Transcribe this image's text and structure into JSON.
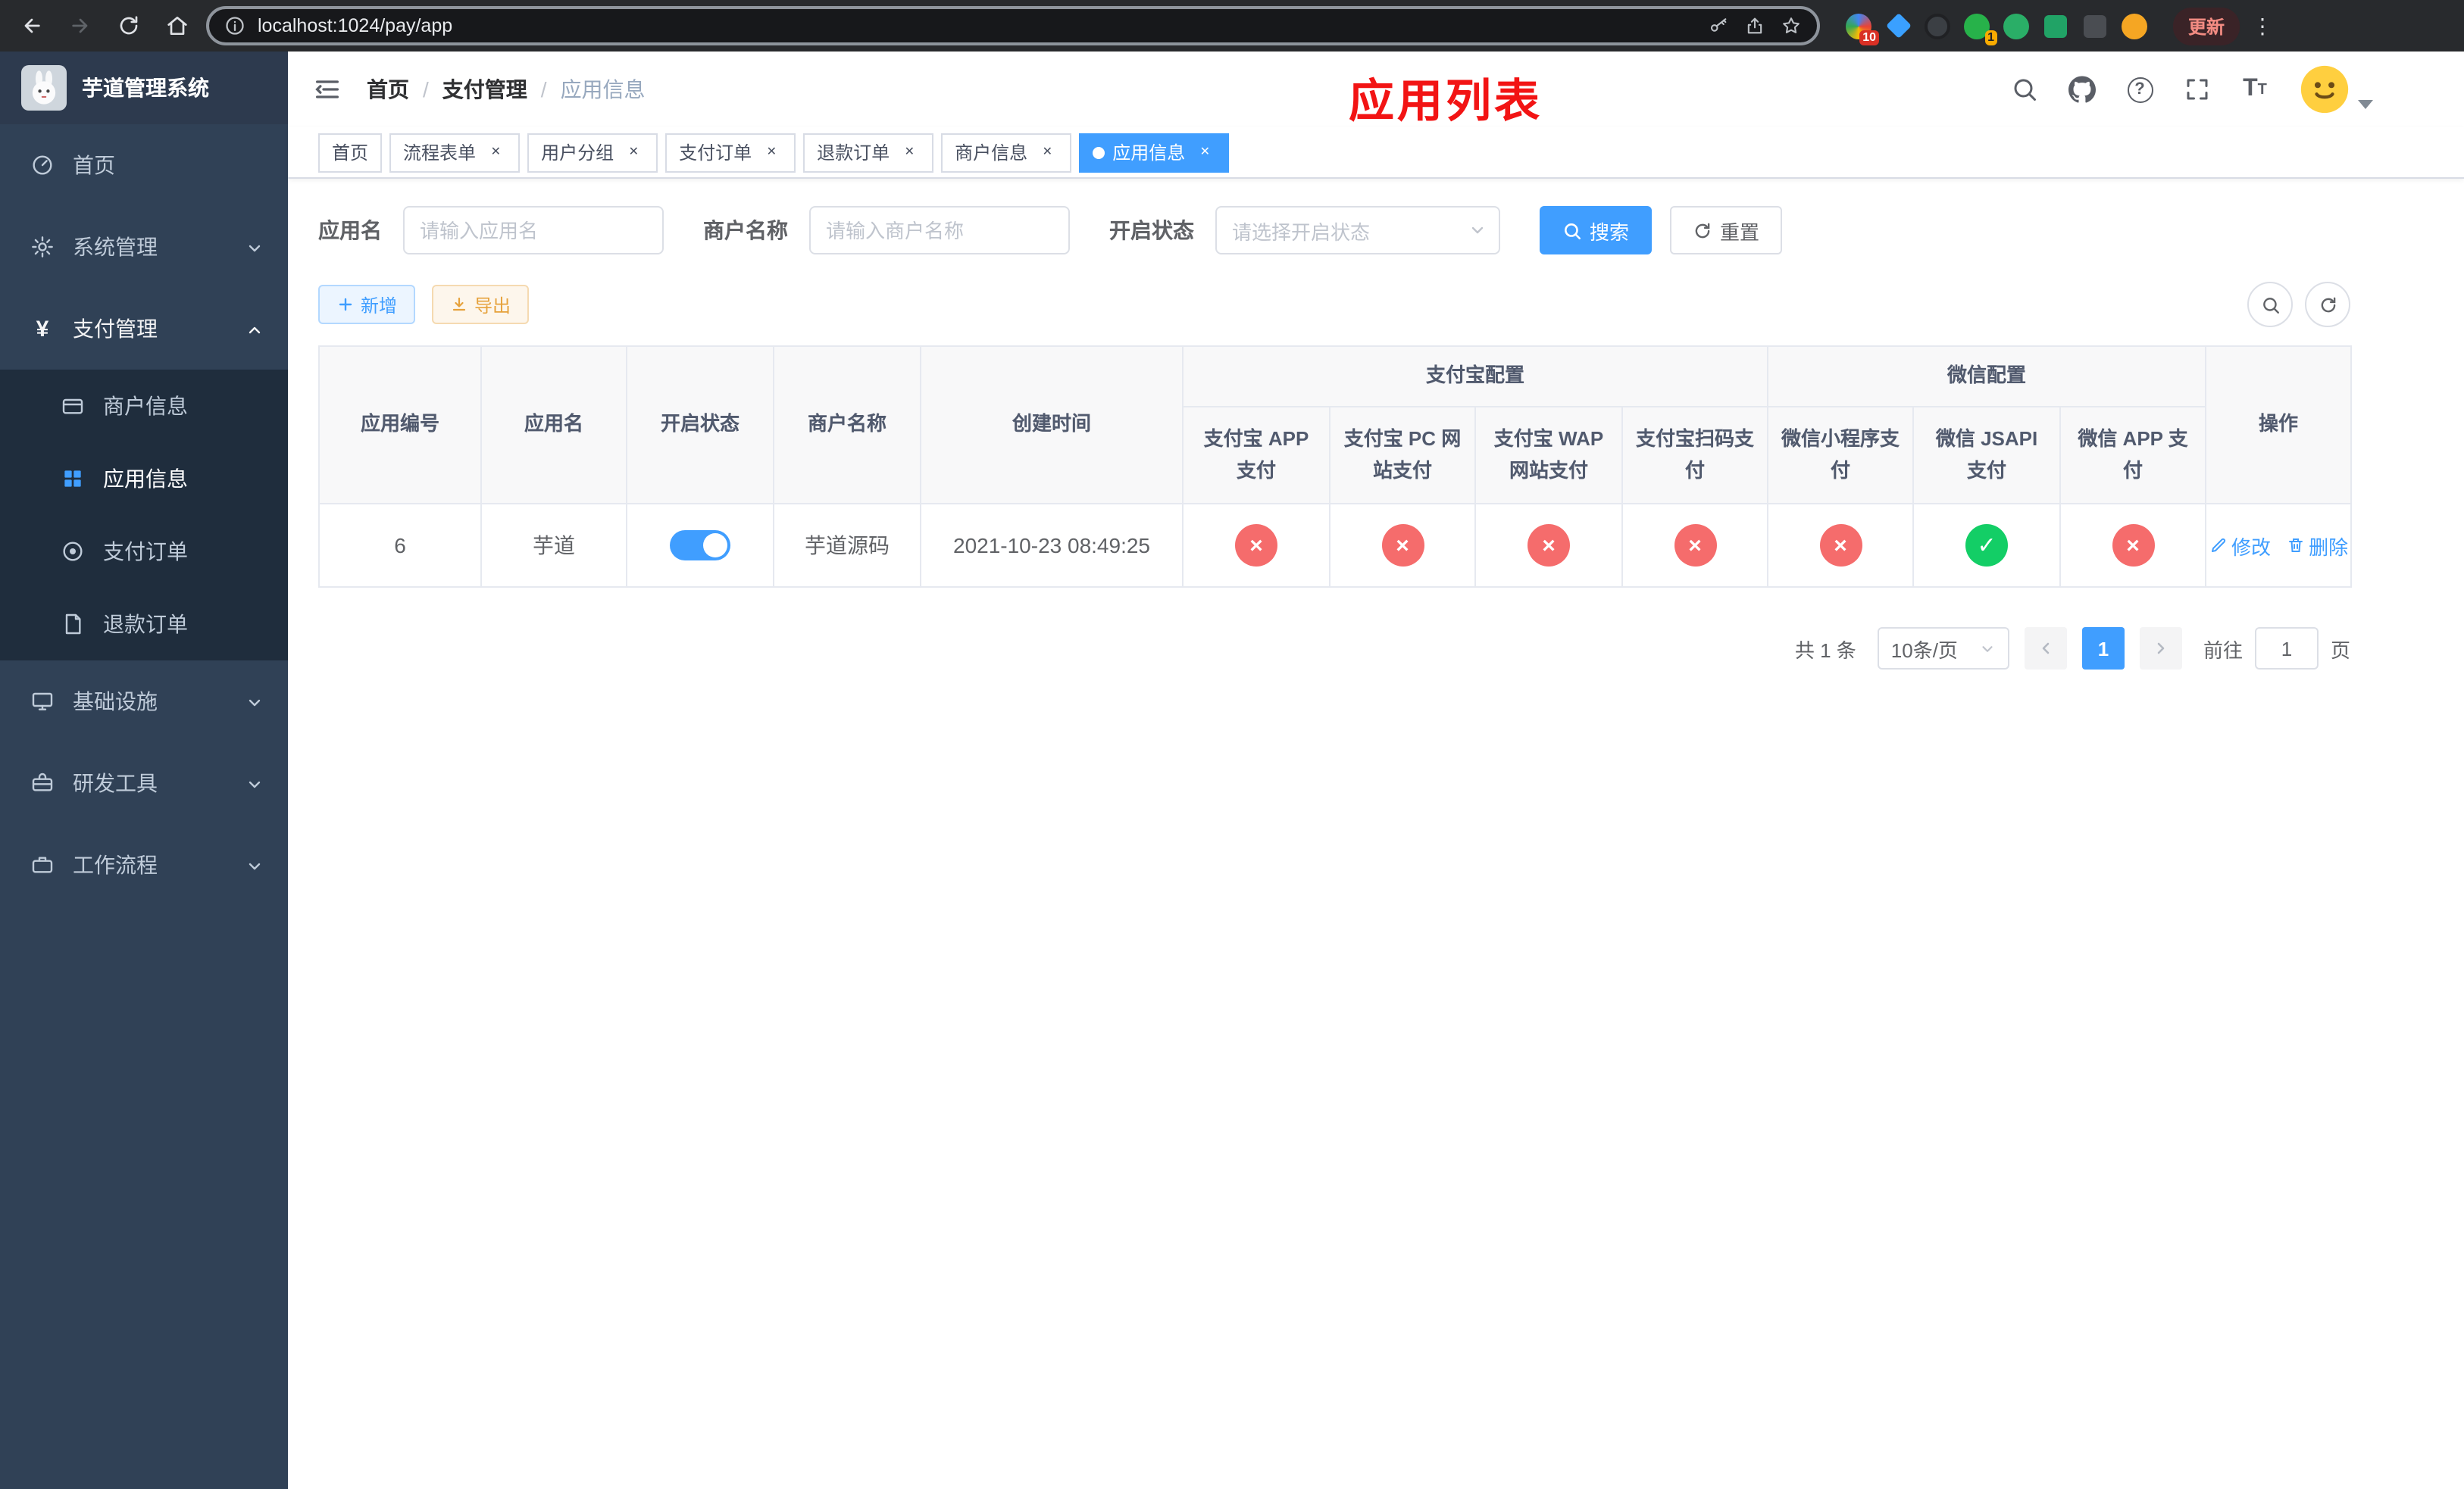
{
  "browser": {
    "url": "localhost:1024/pay/app",
    "update_label": "更新",
    "extension_badge_1": "10",
    "extension_badge_2": "1"
  },
  "sidebar": {
    "title": "芋道管理系统",
    "menu": [
      {
        "label": "首页"
      },
      {
        "label": "系统管理"
      },
      {
        "label": "支付管理"
      },
      {
        "label": "商户信息"
      },
      {
        "label": "应用信息"
      },
      {
        "label": "支付订单"
      },
      {
        "label": "退款订单"
      },
      {
        "label": "基础设施"
      },
      {
        "label": "研发工具"
      },
      {
        "label": "工作流程"
      }
    ]
  },
  "header": {
    "breadcrumb": [
      "首页",
      "支付管理",
      "应用信息"
    ],
    "page_title": "应用列表"
  },
  "tabs": [
    {
      "label": "首页"
    },
    {
      "label": "流程表单"
    },
    {
      "label": "用户分组"
    },
    {
      "label": "支付订单"
    },
    {
      "label": "退款订单"
    },
    {
      "label": "商户信息"
    },
    {
      "label": "应用信息"
    }
  ],
  "filters": {
    "app_name_label": "应用名",
    "app_name_placeholder": "请输入应用名",
    "merchant_label": "商户名称",
    "merchant_placeholder": "请输入商户名称",
    "status_label": "开启状态",
    "status_placeholder": "请选择开启状态",
    "search_label": "搜索",
    "reset_label": "重置"
  },
  "toolbar": {
    "add_label": "新增",
    "export_label": "导出"
  },
  "table": {
    "headers": {
      "app_id": "应用编号",
      "app_name": "应用名",
      "status": "开启状态",
      "merchant": "商户名称",
      "created": "创建时间",
      "alipay_group": "支付宝配置",
      "wechat_group": "微信配置",
      "alipay_app": "支付宝 APP 支付",
      "alipay_pc": "支付宝 PC 网站支付",
      "alipay_wap": "支付宝 WAP 网站支付",
      "alipay_qr": "支付宝扫码支付",
      "wx_mini": "微信小程序支付",
      "wx_jsapi": "微信 JSAPI 支付",
      "wx_app": "微信 APP 支付",
      "actions": "操作"
    },
    "rows": [
      {
        "app_id": "6",
        "app_name": "芋道",
        "status_on": true,
        "merchant": "芋道源码",
        "created": "2021-10-23 08:49:25",
        "configs": [
          "no",
          "no",
          "no",
          "no",
          "no",
          "yes",
          "no"
        ],
        "edit_label": "修改",
        "delete_label": "删除"
      }
    ]
  },
  "pagination": {
    "total": "共 1 条",
    "page_size": "10条/页",
    "current_page": "1",
    "goto_label": "前往",
    "goto_value": "1",
    "unit_label": "页"
  },
  "colors": {
    "primary": "#409eff",
    "danger": "#f56c6c",
    "success": "#13ce66",
    "warning": "#e6a23c",
    "sidebar_bg": "#304156",
    "title_red": "#f21414"
  }
}
